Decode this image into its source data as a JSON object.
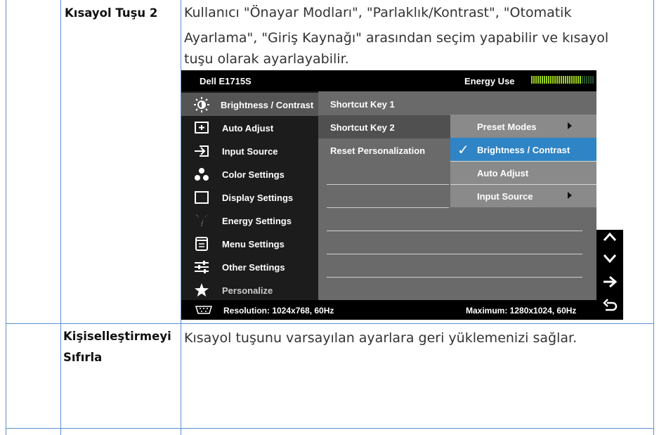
{
  "rows": [
    {
      "label": "Kısayol Tuşu 2",
      "description_lines": [
        "Kullanıcı \"Önayar Modları\", \"Parlaklık/Kontrast\", \"Otomatik",
        "Ayarlama\", \"Giriş Kaynağı\" arasından seçim yapabilir ve kısayol",
        "tuşu olarak ayarlayabilir."
      ]
    },
    {
      "label_lines": [
        "Kişiselleştirmeyi",
        "Sıfırla"
      ],
      "description": "Kısayol tuşunu varsayılan ayarlara geri yüklemenizi sağlar."
    }
  ],
  "osd": {
    "model": "Dell E1715S",
    "energy_label": "Energy Use",
    "energy_level": 0.8,
    "accent_color": "#2f84c6",
    "menu_items": [
      {
        "label": "Brightness / Contrast",
        "icon": "brightness-icon"
      },
      {
        "label": "Auto Adjust",
        "icon": "auto-adjust-icon"
      },
      {
        "label": "Input Source",
        "icon": "input-source-icon"
      },
      {
        "label": "Color Settings",
        "icon": "color-settings-icon"
      },
      {
        "label": "Display Settings",
        "icon": "display-settings-icon"
      },
      {
        "label": "Energy Settings",
        "icon": "energy-settings-icon"
      },
      {
        "label": "Menu Settings",
        "icon": "menu-settings-icon"
      },
      {
        "label": "Other Settings",
        "icon": "other-settings-icon"
      },
      {
        "label": "Personalize",
        "icon": "star-icon",
        "active": true
      }
    ],
    "submenu": [
      {
        "label": "Shortcut Key 1"
      },
      {
        "label": "Shortcut Key 2",
        "selected": true
      },
      {
        "label": "Reset Personalization"
      }
    ],
    "options": [
      {
        "label": "Preset Modes",
        "has_arrow": true
      },
      {
        "label": "Brightness / Contrast",
        "checked": true
      },
      {
        "label": "Auto Adjust"
      },
      {
        "label": "Input Source",
        "has_arrow": true
      }
    ],
    "footer": {
      "resolution": "Resolution: 1024x768, 60Hz",
      "maximum": "Maximum: 1280x1024, 60Hz"
    },
    "nav_buttons": [
      "up-icon",
      "down-icon",
      "right-arrow-icon",
      "back-icon"
    ]
  }
}
